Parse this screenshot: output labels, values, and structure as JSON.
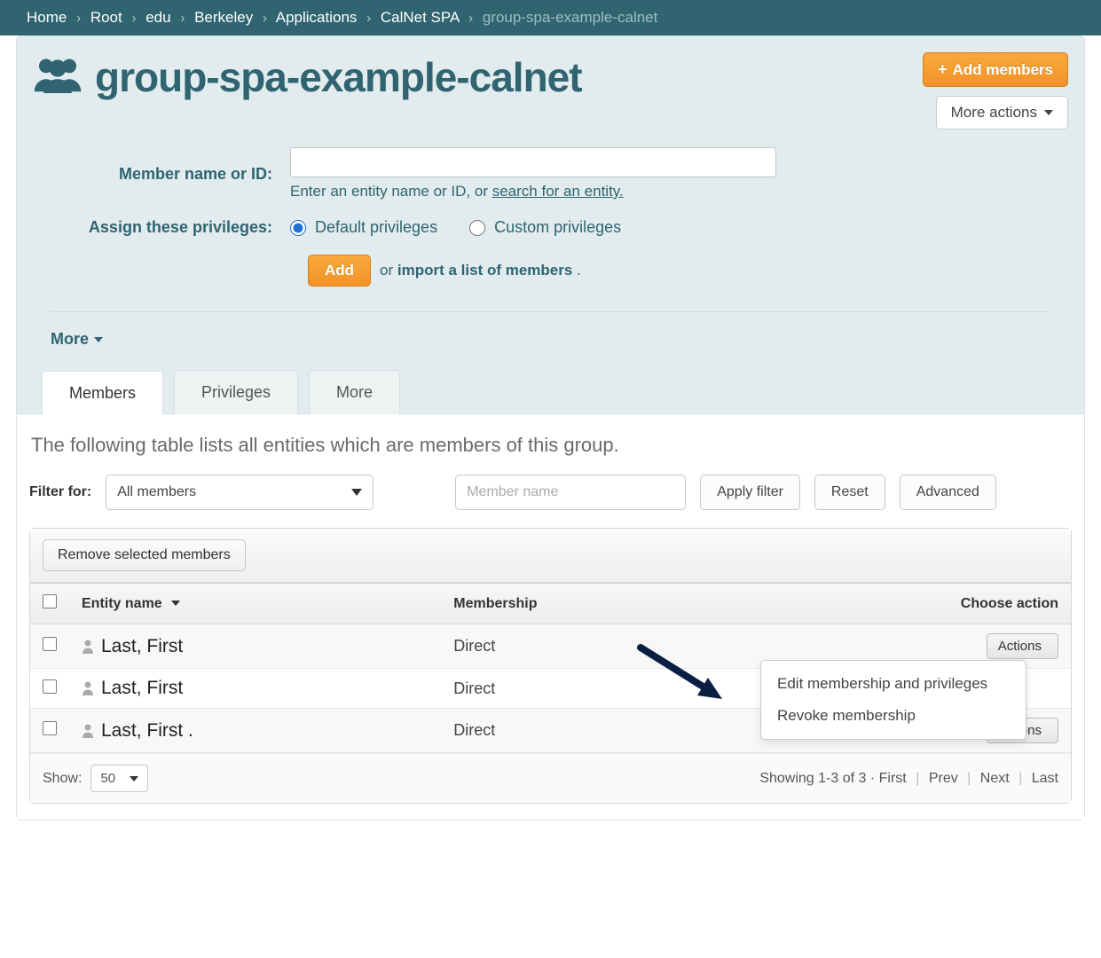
{
  "breadcrumb": {
    "items": [
      "Home",
      "Root",
      "edu",
      "Berkeley",
      "Applications",
      "CalNet SPA"
    ],
    "current": "group-spa-example-calnet"
  },
  "header": {
    "title": "group-spa-example-calnet",
    "add_members": "Add members",
    "more_actions": "More actions"
  },
  "form": {
    "member_label": "Member name or ID:",
    "hint_prefix": "Enter an entity name or ID, or ",
    "hint_link": "search for an entity.",
    "privileges_label": "Assign these privileges:",
    "default_priv": "Default privileges",
    "custom_priv": "Custom privileges",
    "add_btn": "Add",
    "or": "or ",
    "import_link": "import a list of members",
    "period": " ."
  },
  "more_toggle": "More",
  "tabs": {
    "members": "Members",
    "privileges": "Privileges",
    "more": "More"
  },
  "panel": {
    "desc": "The following table lists all entities which are members of this group.",
    "filter_for": "Filter for:",
    "all_members": "All members",
    "name_placeholder": "Member name",
    "apply": "Apply filter",
    "reset": "Reset",
    "advanced": "Advanced"
  },
  "table": {
    "remove_selected": "Remove selected members",
    "col_entity": "Entity name",
    "col_membership": "Membership",
    "col_action": "Choose action",
    "actions_label": "Actions",
    "rows": [
      {
        "name": "Last, First",
        "membership": "Direct"
      },
      {
        "name": "Last, First",
        "membership": "Direct"
      },
      {
        "name": "Last, First     .",
        "membership": "Direct"
      }
    ]
  },
  "dropdown": {
    "edit": "Edit membership and privileges",
    "revoke": "Revoke membership"
  },
  "footer": {
    "show": "Show:",
    "show_value": "50",
    "showing": "Showing 1-3 of 3",
    "first": "First",
    "prev": "Prev",
    "next": "Next",
    "last": "Last"
  }
}
